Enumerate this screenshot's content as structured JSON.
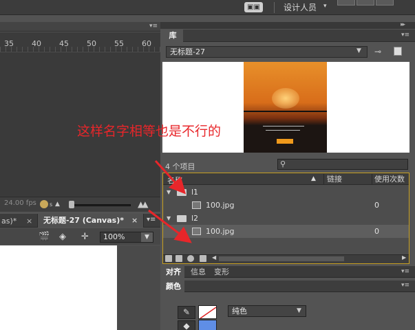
{
  "top_bar": {
    "workspace_label": "设计人员",
    "workspace_arrow": "▾",
    "switch_icon": "workspace-switch-icon"
  },
  "timeline": {
    "ruler_ticks": [
      "35",
      "40",
      "45",
      "50",
      "55",
      "60"
    ],
    "fps": "24.00 fps",
    "fps_sub": "s",
    "panel_menu": "▾≡"
  },
  "document_tabs": [
    {
      "label": "as)*",
      "close": "×"
    },
    {
      "label": "无标题-27 (Canvas)*",
      "close": "×"
    }
  ],
  "stage_toolbar": {
    "zoom": "100%",
    "icons": [
      "clapper-icon",
      "transform-icon",
      "snap-icon"
    ]
  },
  "library": {
    "tab": "库",
    "document": "无标题-27",
    "item_count": "4 个项目",
    "search_placeholder": "",
    "columns": {
      "name": "名称",
      "linkage": "链接",
      "use_count": "使用次数"
    },
    "rows": [
      {
        "type": "folder",
        "name": "l1",
        "expanded": true,
        "use_count": ""
      },
      {
        "type": "image",
        "name": "100.jpg",
        "use_count": "0"
      },
      {
        "type": "folder",
        "name": "l2",
        "expanded": true,
        "use_count": ""
      },
      {
        "type": "image",
        "name": "100.jpg",
        "use_count": "0",
        "selected": true
      }
    ]
  },
  "panel_tabs": {
    "align": "对齐",
    "info": "信息",
    "transform": "变形"
  },
  "color_panel": {
    "tab": "颜色",
    "type": "纯色",
    "fill_color": "#5f8ee6"
  },
  "annotation": {
    "text": "这样名字相等也是不行的",
    "color": "#e8262a"
  }
}
